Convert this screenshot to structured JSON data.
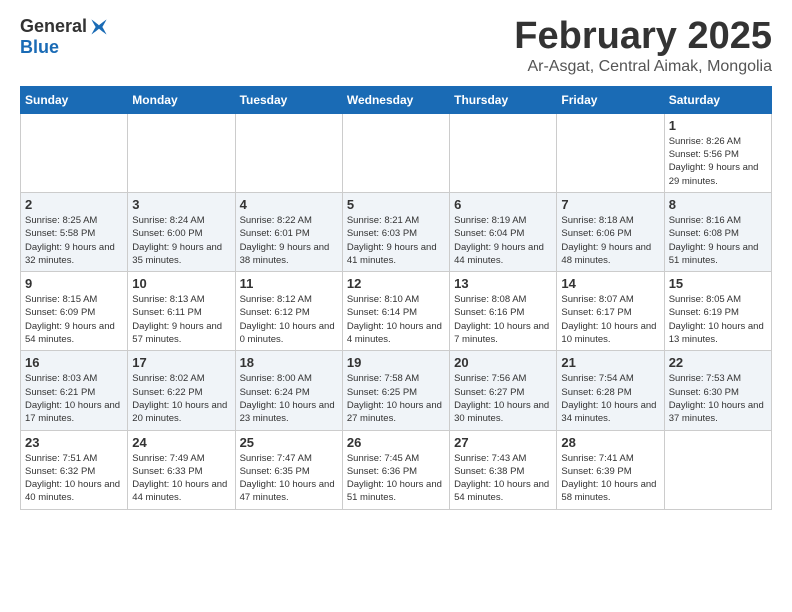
{
  "header": {
    "logo": {
      "general": "General",
      "blue": "Blue"
    },
    "title": "February 2025",
    "subtitle": "Ar-Asgat, Central Aimak, Mongolia"
  },
  "calendar": {
    "weekdays": [
      "Sunday",
      "Monday",
      "Tuesday",
      "Wednesday",
      "Thursday",
      "Friday",
      "Saturday"
    ],
    "weeks": [
      [
        {
          "day": "",
          "info": ""
        },
        {
          "day": "",
          "info": ""
        },
        {
          "day": "",
          "info": ""
        },
        {
          "day": "",
          "info": ""
        },
        {
          "day": "",
          "info": ""
        },
        {
          "day": "",
          "info": ""
        },
        {
          "day": "1",
          "info": "Sunrise: 8:26 AM\nSunset: 5:56 PM\nDaylight: 9 hours and 29 minutes."
        }
      ],
      [
        {
          "day": "2",
          "info": "Sunrise: 8:25 AM\nSunset: 5:58 PM\nDaylight: 9 hours and 32 minutes."
        },
        {
          "day": "3",
          "info": "Sunrise: 8:24 AM\nSunset: 6:00 PM\nDaylight: 9 hours and 35 minutes."
        },
        {
          "day": "4",
          "info": "Sunrise: 8:22 AM\nSunset: 6:01 PM\nDaylight: 9 hours and 38 minutes."
        },
        {
          "day": "5",
          "info": "Sunrise: 8:21 AM\nSunset: 6:03 PM\nDaylight: 9 hours and 41 minutes."
        },
        {
          "day": "6",
          "info": "Sunrise: 8:19 AM\nSunset: 6:04 PM\nDaylight: 9 hours and 44 minutes."
        },
        {
          "day": "7",
          "info": "Sunrise: 8:18 AM\nSunset: 6:06 PM\nDaylight: 9 hours and 48 minutes."
        },
        {
          "day": "8",
          "info": "Sunrise: 8:16 AM\nSunset: 6:08 PM\nDaylight: 9 hours and 51 minutes."
        }
      ],
      [
        {
          "day": "9",
          "info": "Sunrise: 8:15 AM\nSunset: 6:09 PM\nDaylight: 9 hours and 54 minutes."
        },
        {
          "day": "10",
          "info": "Sunrise: 8:13 AM\nSunset: 6:11 PM\nDaylight: 9 hours and 57 minutes."
        },
        {
          "day": "11",
          "info": "Sunrise: 8:12 AM\nSunset: 6:12 PM\nDaylight: 10 hours and 0 minutes."
        },
        {
          "day": "12",
          "info": "Sunrise: 8:10 AM\nSunset: 6:14 PM\nDaylight: 10 hours and 4 minutes."
        },
        {
          "day": "13",
          "info": "Sunrise: 8:08 AM\nSunset: 6:16 PM\nDaylight: 10 hours and 7 minutes."
        },
        {
          "day": "14",
          "info": "Sunrise: 8:07 AM\nSunset: 6:17 PM\nDaylight: 10 hours and 10 minutes."
        },
        {
          "day": "15",
          "info": "Sunrise: 8:05 AM\nSunset: 6:19 PM\nDaylight: 10 hours and 13 minutes."
        }
      ],
      [
        {
          "day": "16",
          "info": "Sunrise: 8:03 AM\nSunset: 6:21 PM\nDaylight: 10 hours and 17 minutes."
        },
        {
          "day": "17",
          "info": "Sunrise: 8:02 AM\nSunset: 6:22 PM\nDaylight: 10 hours and 20 minutes."
        },
        {
          "day": "18",
          "info": "Sunrise: 8:00 AM\nSunset: 6:24 PM\nDaylight: 10 hours and 23 minutes."
        },
        {
          "day": "19",
          "info": "Sunrise: 7:58 AM\nSunset: 6:25 PM\nDaylight: 10 hours and 27 minutes."
        },
        {
          "day": "20",
          "info": "Sunrise: 7:56 AM\nSunset: 6:27 PM\nDaylight: 10 hours and 30 minutes."
        },
        {
          "day": "21",
          "info": "Sunrise: 7:54 AM\nSunset: 6:28 PM\nDaylight: 10 hours and 34 minutes."
        },
        {
          "day": "22",
          "info": "Sunrise: 7:53 AM\nSunset: 6:30 PM\nDaylight: 10 hours and 37 minutes."
        }
      ],
      [
        {
          "day": "23",
          "info": "Sunrise: 7:51 AM\nSunset: 6:32 PM\nDaylight: 10 hours and 40 minutes."
        },
        {
          "day": "24",
          "info": "Sunrise: 7:49 AM\nSunset: 6:33 PM\nDaylight: 10 hours and 44 minutes."
        },
        {
          "day": "25",
          "info": "Sunrise: 7:47 AM\nSunset: 6:35 PM\nDaylight: 10 hours and 47 minutes."
        },
        {
          "day": "26",
          "info": "Sunrise: 7:45 AM\nSunset: 6:36 PM\nDaylight: 10 hours and 51 minutes."
        },
        {
          "day": "27",
          "info": "Sunrise: 7:43 AM\nSunset: 6:38 PM\nDaylight: 10 hours and 54 minutes."
        },
        {
          "day": "28",
          "info": "Sunrise: 7:41 AM\nSunset: 6:39 PM\nDaylight: 10 hours and 58 minutes."
        },
        {
          "day": "",
          "info": ""
        }
      ]
    ]
  }
}
